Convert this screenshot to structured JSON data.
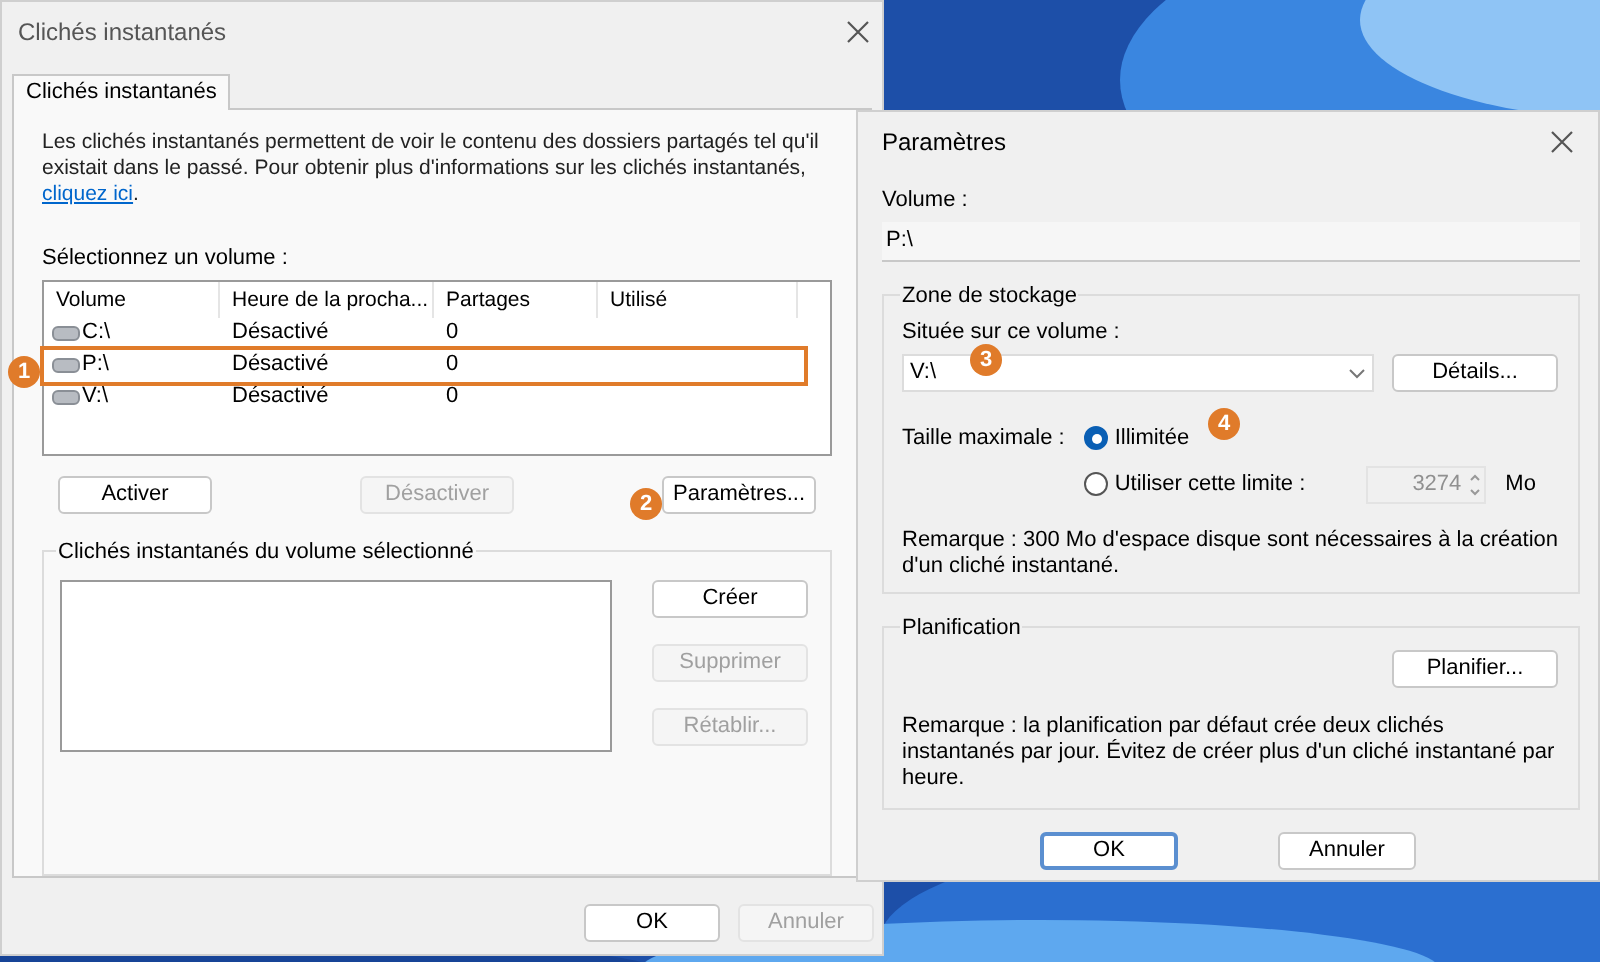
{
  "main_dialog": {
    "title": "Clichés instantanés",
    "tabs": [
      {
        "label": "Clichés instantanés",
        "selected": true
      }
    ],
    "description": "Les clichés instantanés permettent de voir le contenu des dossiers partagés tel qu'il existait dans le passé. Pour obtenir plus d'informations sur les clichés instantanés,",
    "link": "cliquez ici",
    "link_end": ".",
    "volume_label": "Sélectionnez un volume :",
    "columns": [
      "Volume",
      "Heure de la procha...",
      "Partages",
      "Utilisé"
    ],
    "rows": [
      {
        "volume": "C:\\",
        "next_time": "Désactivé",
        "shares": "0",
        "outlined": false
      },
      {
        "volume": "P:\\",
        "next_time": "Désactivé",
        "shares": "0",
        "outlined": true
      },
      {
        "volume": "V:\\",
        "next_time": "Désactivé",
        "shares": "0",
        "outlined": false
      }
    ],
    "volume_buttons": [
      {
        "label": "Activer",
        "disabled": false
      },
      {
        "label": "Désactiver",
        "disabled": true
      },
      {
        "label": "Paramètres...",
        "disabled": false
      }
    ],
    "group_title": "Clichés instantanés du volume sélectionné",
    "group_buttons": [
      {
        "label": "Créer",
        "disabled": false
      },
      {
        "label": "Supprimer",
        "disabled": true
      },
      {
        "label": "Rétablir...",
        "disabled": true
      }
    ],
    "footer_buttons": [
      {
        "label": "OK",
        "disabled": false
      },
      {
        "label": "Annuler",
        "disabled": true
      }
    ]
  },
  "settings_dialog": {
    "title": "Paramètres",
    "volume_label": "Volume :",
    "volume_value": "P:\\",
    "storage_group": "Zone de stockage",
    "location_label": "Située sur ce volume :",
    "location_value": "V:\\",
    "details_button": "Détails...",
    "max_size_label": "Taille maximale :",
    "options": [
      {
        "label": "Illimitée",
        "selected": true
      },
      {
        "label": "Utiliser cette limite :",
        "selected": false
      }
    ],
    "limit_value": "3274",
    "limit_disabled": true,
    "unit": "Mo",
    "storage_note": "Remarque : 300 Mo d'espace disque sont nécessaires à la création d'un cliché instantané.",
    "schedule_group": "Planification",
    "schedule_button": "Planifier...",
    "schedule_note": "Remarque : la planification par défaut crée deux clichés instantanés par jour. Évitez de créer plus d'un cliché instantané par heure.",
    "buttons": [
      {
        "label": "OK",
        "default": true
      },
      {
        "label": "Annuler",
        "default": false
      }
    ]
  },
  "callouts": [
    "1",
    "2",
    "3",
    "4"
  ]
}
